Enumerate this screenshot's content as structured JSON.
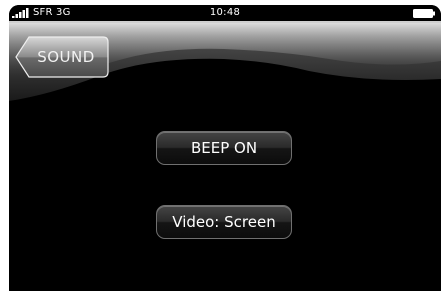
{
  "status_bar": {
    "carrier": "SFR 3G",
    "time": "10:48",
    "signal_icon": "signal-bars-icon",
    "battery_icon": "battery-full-icon"
  },
  "nav": {
    "back_label": "SOUND"
  },
  "buttons": {
    "beep": "BEEP ON",
    "video": "Video: Screen"
  },
  "colors": {
    "background": "#000000",
    "text": "#ffffff",
    "button_border": "#707070"
  }
}
